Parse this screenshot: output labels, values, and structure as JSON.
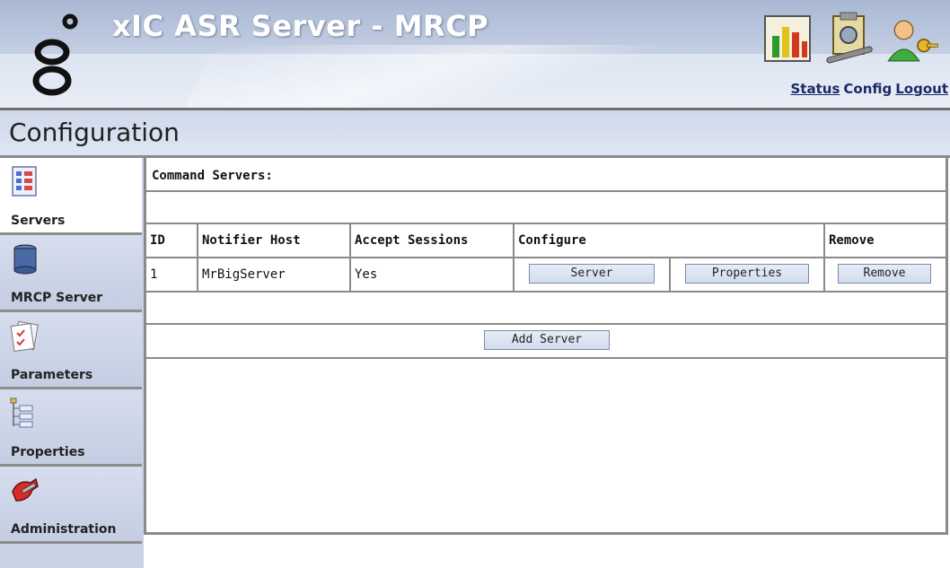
{
  "header": {
    "app_title": "xIC ASR Server - MRCP",
    "links": {
      "status": "Status",
      "config": "Config",
      "logout": "Logout"
    },
    "icons": [
      "status-chart-icon",
      "config-tools-icon",
      "logout-user-key-icon"
    ]
  },
  "page": {
    "title": "Configuration"
  },
  "sidebar": {
    "items": [
      {
        "label": "Servers",
        "icon": "checklist-icon",
        "active": true
      },
      {
        "label": "MRCP Server",
        "icon": "server-db-icon",
        "active": false
      },
      {
        "label": "Parameters",
        "icon": "parameters-doc-icon",
        "active": false
      },
      {
        "label": "Properties",
        "icon": "properties-tree-icon",
        "active": false
      },
      {
        "label": "Administration",
        "icon": "administration-wrench-icon",
        "active": false
      }
    ]
  },
  "main": {
    "section_title": "Command Servers:",
    "table": {
      "headers": {
        "id": "ID",
        "host": "Notifier Host",
        "accept": "Accept Sessions",
        "configure": "Configure",
        "remove": "Remove"
      },
      "rows": [
        {
          "id": "1",
          "host": "MrBigServer",
          "accept": "Yes",
          "server_btn": "Server",
          "properties_btn": "Properties",
          "remove_btn": "Remove"
        }
      ]
    },
    "add_button": "Add Server"
  },
  "colors": {
    "header_bg": "#c9d3e6",
    "link": "#1b2a66",
    "sidebar_bg": "#c9d1e4",
    "button_bg": "#d3dcee"
  }
}
